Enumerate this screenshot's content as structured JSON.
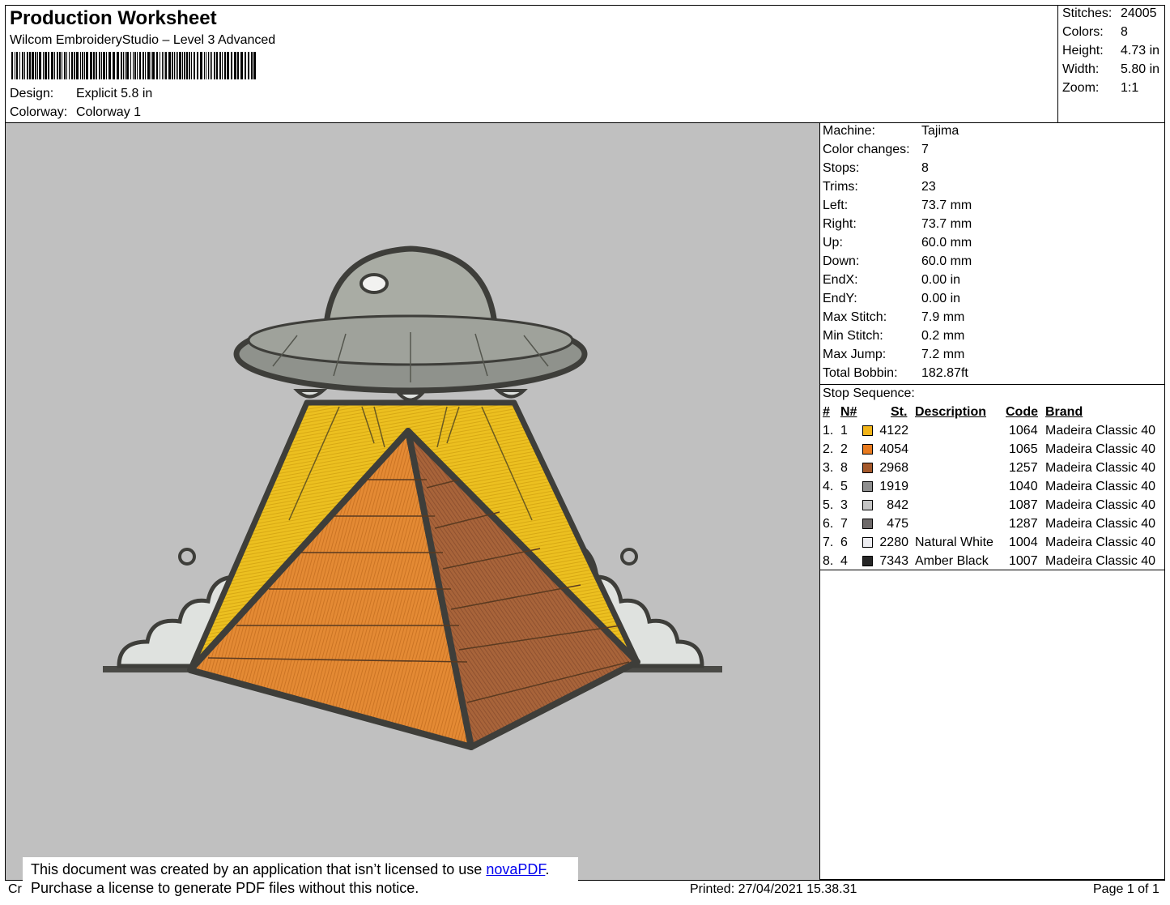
{
  "header": {
    "title": "Production Worksheet",
    "software": "Wilcom EmbroideryStudio – Level 3 Advanced",
    "design_label": "Design:",
    "design_value": "Explicit 5.8 in",
    "colorway_label": "Colorway:",
    "colorway_value": "Colorway 1"
  },
  "summary": [
    {
      "label": "Stitches:",
      "value": "24005"
    },
    {
      "label": "Colors:",
      "value": "8"
    },
    {
      "label": "Height:",
      "value": "4.73 in"
    },
    {
      "label": "Width:",
      "value": "5.80 in"
    },
    {
      "label": "Zoom:",
      "value": "1:1"
    }
  ],
  "machine_info": [
    {
      "label": "Machine:",
      "value": "Tajima"
    },
    {
      "label": "Color changes:",
      "value": "7"
    },
    {
      "label": "Stops:",
      "value": "8"
    },
    {
      "label": "Trims:",
      "value": "23"
    },
    {
      "label": "Left:",
      "value": "73.7 mm"
    },
    {
      "label": "Right:",
      "value": "73.7 mm"
    },
    {
      "label": "Up:",
      "value": "60.0 mm"
    },
    {
      "label": "Down:",
      "value": "60.0 mm"
    },
    {
      "label": "EndX:",
      "value": "0.00 in"
    },
    {
      "label": "EndY:",
      "value": "0.00 in"
    },
    {
      "label": "Max Stitch:",
      "value": "7.9 mm"
    },
    {
      "label": "Min Stitch:",
      "value": "0.2 mm"
    },
    {
      "label": "Max Jump:",
      "value": "7.2 mm"
    },
    {
      "label": "Total Bobbin:",
      "value": "182.87ft"
    }
  ],
  "stop_sequence": {
    "title": "Stop Sequence:",
    "headers": {
      "num": "#",
      "n": "N#",
      "st": "St.",
      "desc": "Description",
      "code": "Code",
      "brand": "Brand"
    },
    "rows": [
      {
        "num": "1.",
        "n": "1",
        "color": "#f2b418",
        "st": "4122",
        "desc": "",
        "code": "1064",
        "brand": "Madeira Classic 40"
      },
      {
        "num": "2.",
        "n": "2",
        "color": "#e87a1e",
        "st": "4054",
        "desc": "",
        "code": "1065",
        "brand": "Madeira Classic 40"
      },
      {
        "num": "3.",
        "n": "8",
        "color": "#a4582a",
        "st": "2968",
        "desc": "",
        "code": "1257",
        "brand": "Madeira Classic 40"
      },
      {
        "num": "4.",
        "n": "5",
        "color": "#8e8e8e",
        "st": "1919",
        "desc": "",
        "code": "1040",
        "brand": "Madeira Classic 40"
      },
      {
        "num": "5.",
        "n": "3",
        "color": "#c4c4c4",
        "st": "842",
        "desc": "",
        "code": "1087",
        "brand": "Madeira Classic 40"
      },
      {
        "num": "6.",
        "n": "7",
        "color": "#6e6a6a",
        "st": "475",
        "desc": "",
        "code": "1287",
        "brand": "Madeira Classic 40"
      },
      {
        "num": "7.",
        "n": "6",
        "color": "#eeeef2",
        "st": "2280",
        "desc": "Natural White",
        "code": "1004",
        "brand": "Madeira Classic 40"
      },
      {
        "num": "8.",
        "n": "4",
        "color": "#262626",
        "st": "7343",
        "desc": "Amber Black",
        "code": "1007",
        "brand": "Madeira Classic 40"
      }
    ]
  },
  "footer": {
    "left_text": "Cr",
    "printed": "Printed: 27/04/2021 15.38.31",
    "page": "Page 1 of 1"
  },
  "notice": {
    "line1_prefix": "This document was created by an application that isn’t licensed to use ",
    "link": "novaPDF",
    "line1_suffix": ".",
    "line2": "Purchase a license to generate PDF files without this notice."
  }
}
